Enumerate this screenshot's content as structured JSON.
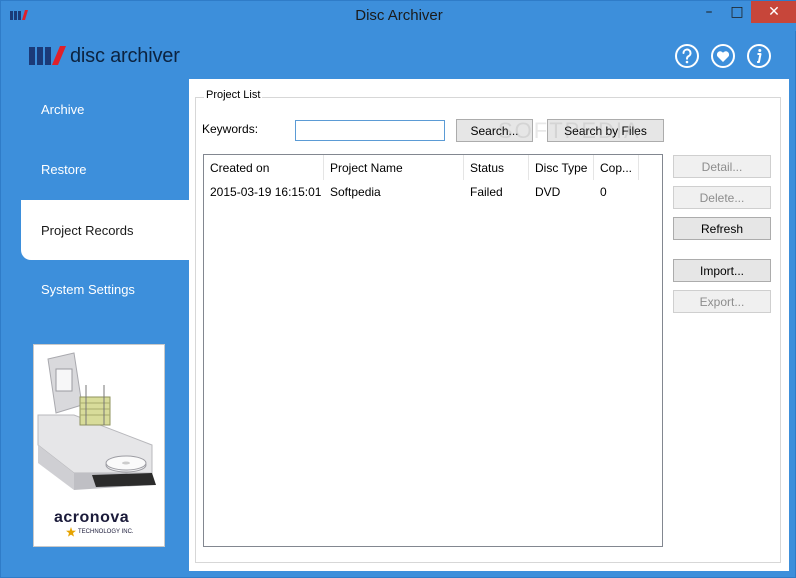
{
  "window": {
    "title": "Disc Archiver",
    "controls": {
      "minimize": "–",
      "maximize": "□",
      "close": "✕"
    }
  },
  "header": {
    "logo_text": "disc archiver",
    "icons": [
      "help-icon",
      "heart-icon",
      "info-icon"
    ]
  },
  "sidebar": {
    "items": [
      {
        "label": "Archive",
        "active": false
      },
      {
        "label": "Restore",
        "active": false
      },
      {
        "label": "Project Records",
        "active": true
      },
      {
        "label": "System Settings",
        "active": false
      }
    ],
    "promo": {
      "brand": "acronova",
      "tagline": "TECHNOLOGY INC."
    }
  },
  "project_list": {
    "group_title": "Project List",
    "keywords_label": "Keywords:",
    "keywords_value": "",
    "search_label": "Search...",
    "search_files_label": "Search by Files",
    "columns": [
      "Created on",
      "Project Name",
      "Status",
      "Disc Type",
      "Cop..."
    ],
    "rows": [
      {
        "created_on": "2015-03-19 16:15:01",
        "project_name": "Softpedia",
        "status": "Failed",
        "disc_type": "DVD",
        "copies": "0"
      }
    ],
    "actions": {
      "detail": "Detail...",
      "delete": "Delete...",
      "refresh": "Refresh",
      "import": "Import...",
      "export": "Export..."
    }
  },
  "watermark": "SOFTPEDIA",
  "colors": {
    "accent": "#3d8fdb",
    "close": "#c7463a",
    "brand_red": "#e0202a",
    "brand_navy": "#1b3a78"
  }
}
